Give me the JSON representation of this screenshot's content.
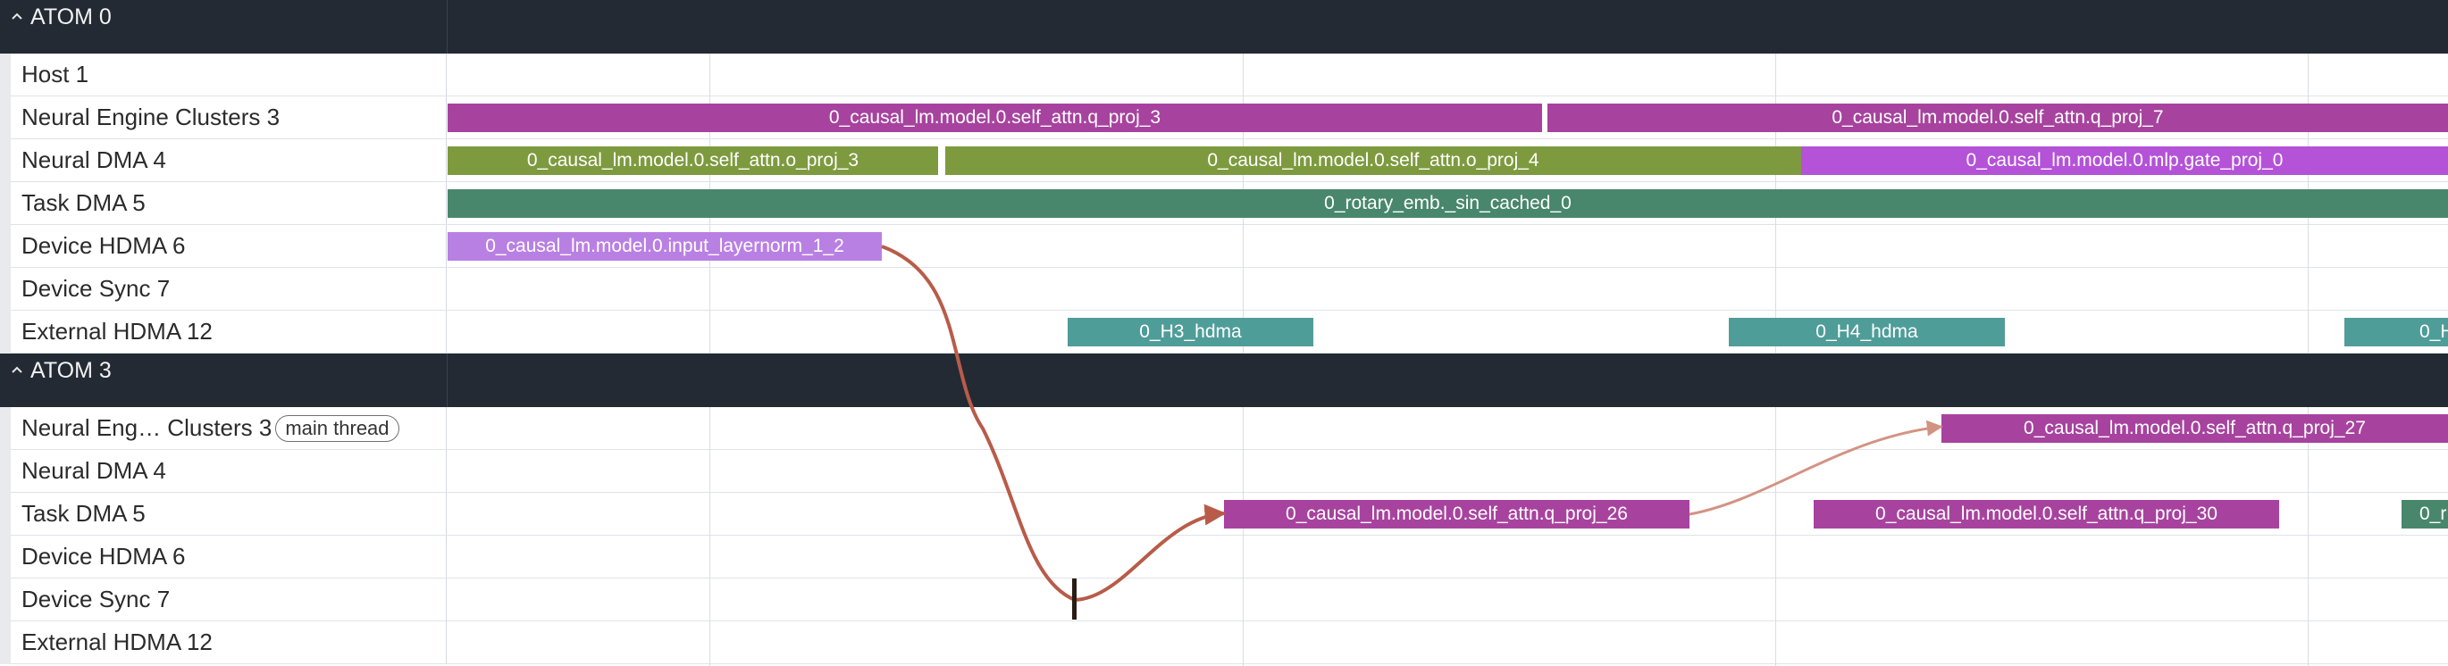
{
  "groups": [
    {
      "title": "ATOM 0",
      "rows": [
        {
          "label": "Host 1"
        },
        {
          "label": "Neural Engine Clusters 3"
        },
        {
          "label": "Neural DMA 4"
        },
        {
          "label": "Task DMA 5"
        },
        {
          "label": "Device HDMA 6"
        },
        {
          "label": "Device Sync 7"
        },
        {
          "label": "External HDMA 12"
        }
      ]
    },
    {
      "title": "ATOM 3",
      "rows": [
        {
          "label": "Neural Eng… Clusters 3",
          "badge": "main thread"
        },
        {
          "label": "Neural DMA 4"
        },
        {
          "label": "Task DMA 5"
        },
        {
          "label": "Device HDMA 6"
        },
        {
          "label": "Device Sync 7"
        },
        {
          "label": "External HDMA 12"
        }
      ]
    }
  ],
  "slices": {
    "a0_nec_q3": "0_causal_lm.model.0.self_attn.q_proj_3",
    "a0_nec_q7": "0_causal_lm.model.0.self_attn.q_proj_7",
    "a0_ndma_o3": "0_causal_lm.model.0.self_attn.o_proj_3",
    "a0_ndma_o4": "0_causal_lm.model.0.self_attn.o_proj_4",
    "a0_ndma_gate0": "0_causal_lm.model.0.mlp.gate_proj_0",
    "a0_tdma_rotary": "0_rotary_emb._sin_cached_0",
    "a0_hdma_layernorm": "0_causal_lm.model.0.input_layernorm_1_2",
    "a0_ext_h3": "0_H3_hdma",
    "a0_ext_h4": "0_H4_hdma",
    "a0_ext_h5_partial": "0_H",
    "a3_nec_q27": "0_causal_lm.model.0.self_attn.q_proj_27",
    "a3_tdma_q26": "0_causal_lm.model.0.self_attn.q_proj_26",
    "a3_tdma_q30": "0_causal_lm.model.0.self_attn.q_proj_30",
    "a3_tdma_partial": "0_r"
  },
  "colors": {
    "header_bg": "#232a33",
    "magenta": "#a7439e",
    "olive": "#7e9a3f",
    "violet": "#b452d8",
    "green": "#48876b",
    "lavender": "#b980e3",
    "teal": "#4f9d99",
    "flow": "#b85c49",
    "flow_light": "#d39383"
  },
  "icons": {
    "group_toggle": "chevron-up-icon"
  }
}
